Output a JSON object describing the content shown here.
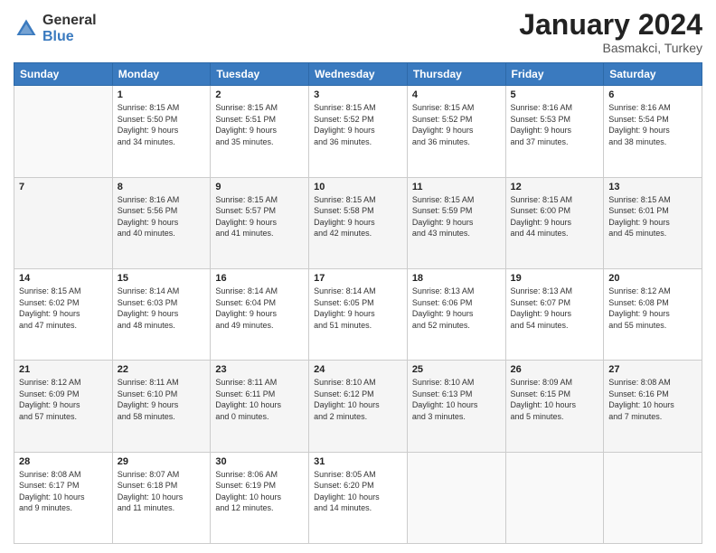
{
  "logo": {
    "general": "General",
    "blue": "Blue"
  },
  "header": {
    "month_year": "January 2024",
    "location": "Basmakci, Turkey"
  },
  "columns": [
    "Sunday",
    "Monday",
    "Tuesday",
    "Wednesday",
    "Thursday",
    "Friday",
    "Saturday"
  ],
  "weeks": [
    [
      {
        "day": "",
        "info": ""
      },
      {
        "day": "1",
        "info": "Sunrise: 8:15 AM\nSunset: 5:50 PM\nDaylight: 9 hours\nand 34 minutes."
      },
      {
        "day": "2",
        "info": "Sunrise: 8:15 AM\nSunset: 5:51 PM\nDaylight: 9 hours\nand 35 minutes."
      },
      {
        "day": "3",
        "info": "Sunrise: 8:15 AM\nSunset: 5:52 PM\nDaylight: 9 hours\nand 36 minutes."
      },
      {
        "day": "4",
        "info": "Sunrise: 8:15 AM\nSunset: 5:52 PM\nDaylight: 9 hours\nand 36 minutes."
      },
      {
        "day": "5",
        "info": "Sunrise: 8:16 AM\nSunset: 5:53 PM\nDaylight: 9 hours\nand 37 minutes."
      },
      {
        "day": "6",
        "info": "Sunrise: 8:16 AM\nSunset: 5:54 PM\nDaylight: 9 hours\nand 38 minutes."
      }
    ],
    [
      {
        "day": "7",
        "info": ""
      },
      {
        "day": "8",
        "info": "Sunrise: 8:16 AM\nSunset: 5:56 PM\nDaylight: 9 hours\nand 40 minutes."
      },
      {
        "day": "9",
        "info": "Sunrise: 8:15 AM\nSunset: 5:57 PM\nDaylight: 9 hours\nand 41 minutes."
      },
      {
        "day": "10",
        "info": "Sunrise: 8:15 AM\nSunset: 5:58 PM\nDaylight: 9 hours\nand 42 minutes."
      },
      {
        "day": "11",
        "info": "Sunrise: 8:15 AM\nSunset: 5:59 PM\nDaylight: 9 hours\nand 43 minutes."
      },
      {
        "day": "12",
        "info": "Sunrise: 8:15 AM\nSunset: 6:00 PM\nDaylight: 9 hours\nand 44 minutes."
      },
      {
        "day": "13",
        "info": "Sunrise: 8:15 AM\nSunset: 6:01 PM\nDaylight: 9 hours\nand 45 minutes."
      }
    ],
    [
      {
        "day": "14",
        "info": "Sunrise: 8:15 AM\nSunset: 6:02 PM\nDaylight: 9 hours\nand 47 minutes."
      },
      {
        "day": "15",
        "info": "Sunrise: 8:14 AM\nSunset: 6:03 PM\nDaylight: 9 hours\nand 48 minutes."
      },
      {
        "day": "16",
        "info": "Sunrise: 8:14 AM\nSunset: 6:04 PM\nDaylight: 9 hours\nand 49 minutes."
      },
      {
        "day": "17",
        "info": "Sunrise: 8:14 AM\nSunset: 6:05 PM\nDaylight: 9 hours\nand 51 minutes."
      },
      {
        "day": "18",
        "info": "Sunrise: 8:13 AM\nSunset: 6:06 PM\nDaylight: 9 hours\nand 52 minutes."
      },
      {
        "day": "19",
        "info": "Sunrise: 8:13 AM\nSunset: 6:07 PM\nDaylight: 9 hours\nand 54 minutes."
      },
      {
        "day": "20",
        "info": "Sunrise: 8:12 AM\nSunset: 6:08 PM\nDaylight: 9 hours\nand 55 minutes."
      }
    ],
    [
      {
        "day": "21",
        "info": "Sunrise: 8:12 AM\nSunset: 6:09 PM\nDaylight: 9 hours\nand 57 minutes."
      },
      {
        "day": "22",
        "info": "Sunrise: 8:11 AM\nSunset: 6:10 PM\nDaylight: 9 hours\nand 58 minutes."
      },
      {
        "day": "23",
        "info": "Sunrise: 8:11 AM\nSunset: 6:11 PM\nDaylight: 10 hours\nand 0 minutes."
      },
      {
        "day": "24",
        "info": "Sunrise: 8:10 AM\nSunset: 6:12 PM\nDaylight: 10 hours\nand 2 minutes."
      },
      {
        "day": "25",
        "info": "Sunrise: 8:10 AM\nSunset: 6:13 PM\nDaylight: 10 hours\nand 3 minutes."
      },
      {
        "day": "26",
        "info": "Sunrise: 8:09 AM\nSunset: 6:15 PM\nDaylight: 10 hours\nand 5 minutes."
      },
      {
        "day": "27",
        "info": "Sunrise: 8:08 AM\nSunset: 6:16 PM\nDaylight: 10 hours\nand 7 minutes."
      }
    ],
    [
      {
        "day": "28",
        "info": "Sunrise: 8:08 AM\nSunset: 6:17 PM\nDaylight: 10 hours\nand 9 minutes."
      },
      {
        "day": "29",
        "info": "Sunrise: 8:07 AM\nSunset: 6:18 PM\nDaylight: 10 hours\nand 11 minutes."
      },
      {
        "day": "30",
        "info": "Sunrise: 8:06 AM\nSunset: 6:19 PM\nDaylight: 10 hours\nand 12 minutes."
      },
      {
        "day": "31",
        "info": "Sunrise: 8:05 AM\nSunset: 6:20 PM\nDaylight: 10 hours\nand 14 minutes."
      },
      {
        "day": "",
        "info": ""
      },
      {
        "day": "",
        "info": ""
      },
      {
        "day": "",
        "info": ""
      }
    ]
  ]
}
